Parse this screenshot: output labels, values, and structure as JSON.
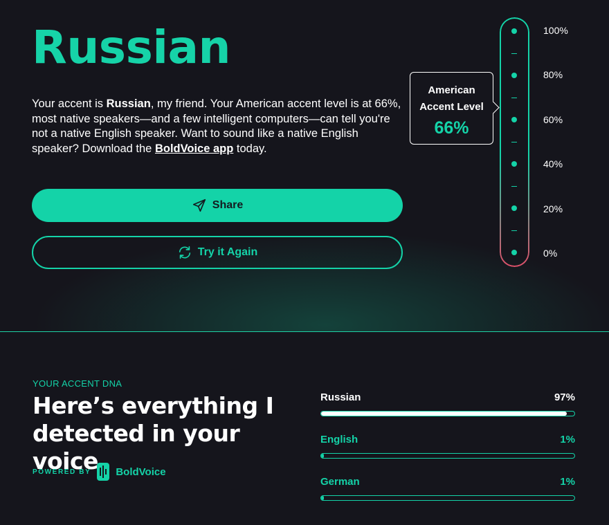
{
  "result": {
    "accent": "Russian",
    "description": {
      "p1": "Your accent is ",
      "accent_bold": "Russian",
      "p2": ", my friend. Your American accent level is at 66%, most native speakers—and a few intelligent computers—can tell you're not a native English speaker. Want to sound like a native English speaker? Download the ",
      "link": "BoldVoice app",
      "p3": " today."
    }
  },
  "buttons": {
    "share_label": "Share",
    "again_label": "Try it Again"
  },
  "gauge": {
    "labels": [
      "100%",
      "80%",
      "60%",
      "40%",
      "20%",
      "0%"
    ],
    "tooltip_label_1": "American",
    "tooltip_label_2": "Accent Level",
    "tooltip_value": "66%",
    "level": 0.66
  },
  "dna": {
    "kicker": "YOUR ACCENT DNA",
    "heading": "Here’s everything I detected in your voice",
    "powered_by": "POWERED BY",
    "brand": "BoldVoice",
    "items": [
      {
        "name": "Russian",
        "value": "97%",
        "fraction": 0.97,
        "active": true
      },
      {
        "name": "English",
        "value": "1%",
        "fraction": 0.01,
        "active": false
      },
      {
        "name": "German",
        "value": "1%",
        "fraction": 0.01,
        "active": false
      }
    ]
  },
  "colors": {
    "accent": "#14d3a8",
    "background": "#15151c",
    "gauge_bottom": "#e0506a",
    "active_bar": "#ffffff"
  }
}
